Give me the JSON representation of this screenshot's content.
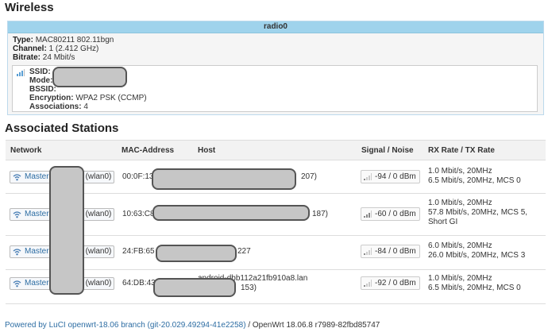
{
  "wireless": {
    "title": "Wireless",
    "radio": {
      "name": "radio0",
      "type_label": "Type:",
      "type_value": "MAC80211 802.11bgn",
      "channel_label": "Channel:",
      "channel_value": "1 (2.412 GHz)",
      "bitrate_label": "Bitrate:",
      "bitrate_value": "24 Mbit/s"
    },
    "iface": {
      "ssid_label": "SSID:",
      "mode_label": "Mode:",
      "bssid_label": "BSSID:",
      "encryption_label": "Encryption:",
      "encryption_value": "WPA2 PSK (CCMP)",
      "associations_label": "Associations:",
      "associations_value": "4"
    }
  },
  "stations": {
    "title": "Associated Stations",
    "headers": {
      "network": "Network",
      "mac": "MAC-Address",
      "host": "Host",
      "signal": "Signal / Noise",
      "rate": "RX Rate / TX Rate"
    },
    "rows": [
      {
        "network": "Master",
        "device": "(wlan0)",
        "mac": "00:0F:13",
        "host": "207)",
        "signal": "-94 / 0 dBm",
        "rate": [
          "1.0 Mbit/s, 20MHz",
          "6.5 Mbit/s, 20MHz, MCS 0"
        ]
      },
      {
        "network": "Master",
        "device": "(wlan0)",
        "mac": "10:63:C8",
        "host": "187)",
        "signal": "-60 / 0 dBm",
        "rate": [
          "1.0 Mbit/s, 20MHz",
          "57.8 Mbit/s, 20MHz, MCS 5,",
          "Short GI"
        ]
      },
      {
        "network": "Master",
        "device": "(wlan0)",
        "mac": "24:FB:65",
        "host": "227",
        "signal": "-84 / 0 dBm",
        "rate": [
          "6.0 Mbit/s, 20MHz",
          "26.0 Mbit/s, 20MHz, MCS 3"
        ]
      },
      {
        "network": "Master",
        "device": "(wlan0)",
        "mac": "64:DB:43",
        "host": "android-dbb112a21fb910a8.lan",
        "host2": "153)",
        "signal": "-92 / 0 dBm",
        "rate": [
          "1.0 Mbit/s, 20MHz",
          "6.5 Mbit/s, 20MHz, MCS 0"
        ]
      }
    ]
  },
  "footer": {
    "link": "Powered by LuCI openwrt-18.06 branch (git-20.029.49294-41e2258)",
    "text": " / OpenWrt 18.06.8 r7989-82fbd85747"
  },
  "colors": {
    "header_bar": "#9fd3ec",
    "link": "#2d6da3",
    "redaction": "#c6c6c6"
  },
  "icons": [
    "signal-icon",
    "wifi-icon"
  ]
}
